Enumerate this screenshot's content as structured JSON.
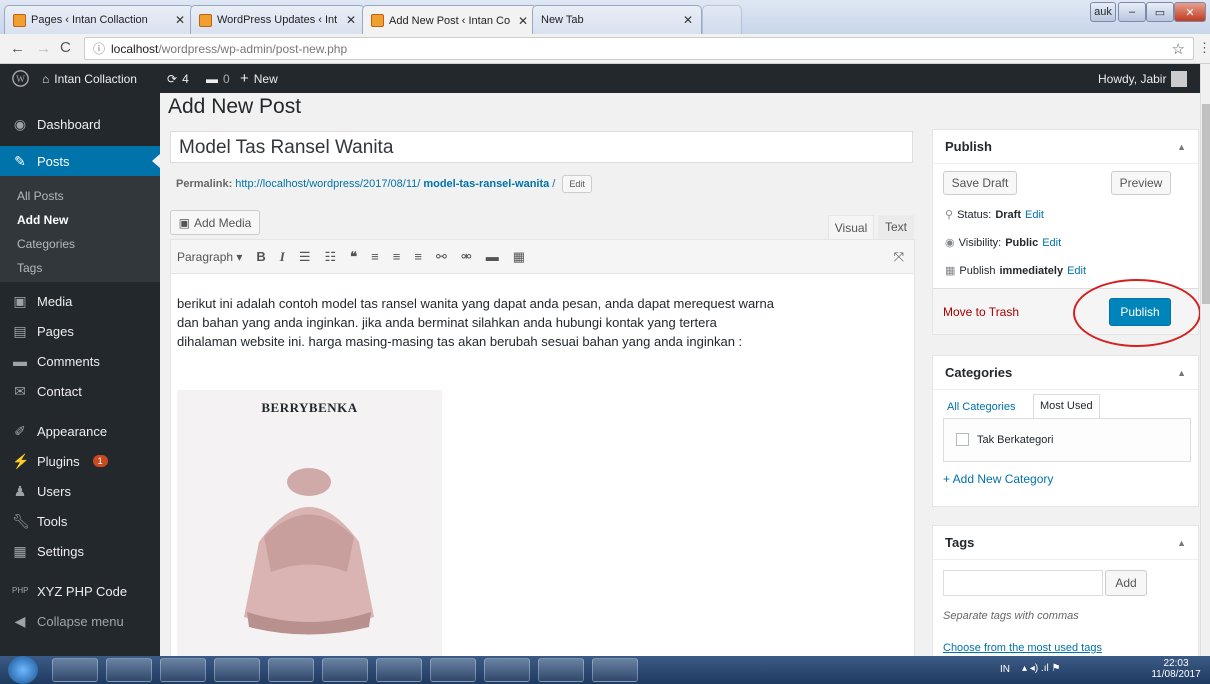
{
  "browser": {
    "tabs": [
      {
        "title": "Pages ‹ Intan Collaction"
      },
      {
        "title": "WordPress Updates ‹ Int"
      },
      {
        "title": "Add New Post ‹ Intan Co"
      },
      {
        "title": "New Tab"
      }
    ],
    "window_user": "auk",
    "url_host": "localhost",
    "url_path": "/wordpress/wp-admin/post-new.php"
  },
  "adminbar": {
    "site_name": "Intan Collaction",
    "updates_count": "4",
    "comments_count": "0",
    "new_label": "New",
    "greeting": "Howdy, Jabir"
  },
  "sidebar": {
    "items": [
      {
        "label": "Dashboard",
        "icon": "dashboard-icon"
      },
      {
        "label": "Posts",
        "icon": "pin-icon"
      },
      {
        "label": "Media",
        "icon": "media-icon"
      },
      {
        "label": "Pages",
        "icon": "pages-icon"
      },
      {
        "label": "Comments",
        "icon": "comment-icon"
      },
      {
        "label": "Contact",
        "icon": "mail-icon"
      },
      {
        "label": "Appearance",
        "icon": "brush-icon"
      },
      {
        "label": "Plugins",
        "icon": "plugin-icon"
      },
      {
        "label": "Users",
        "icon": "users-icon"
      },
      {
        "label": "Tools",
        "icon": "wrench-icon"
      },
      {
        "label": "Settings",
        "icon": "settings-icon"
      },
      {
        "label": "XYZ PHP Code",
        "icon": "php-icon"
      },
      {
        "label": "Collapse menu",
        "icon": "collapse-icon"
      }
    ],
    "submenu": [
      "All Posts",
      "Add New",
      "Categories",
      "Tags"
    ],
    "plugins_badge": "1"
  },
  "post": {
    "page_title": "Add New Post",
    "title_value": "Model Tas Ransel Wanita",
    "permalink_label": "Permalink:",
    "permalink_base": "http://localhost/wordpress/2017/08/11/",
    "permalink_slug": "model-tas-ransel-wanita",
    "permalink_edit": "Edit",
    "add_media": "Add Media",
    "tab_visual": "Visual",
    "tab_text": "Text",
    "format_select": "Paragraph",
    "content": "berikut ini adalah contoh model tas ransel wanita yang dapat anda pesan, anda dapat merequest warna dan bahan yang anda inginkan. jika anda berminat silahkan anda hubungi kontak yang tertera dihalaman website ini. harga masing-masing tas akan berubah sesuai bahan yang anda inginkan :",
    "image_brand": "BERRYBENKA"
  },
  "publish": {
    "heading": "Publish",
    "save_draft": "Save Draft",
    "preview": "Preview",
    "status_label": "Status:",
    "status_value": "Draft",
    "visibility_label": "Visibility:",
    "visibility_value": "Public",
    "schedule_label": "Publish",
    "schedule_value": "immediately",
    "edit": "Edit",
    "trash": "Move to Trash",
    "publish_button": "Publish"
  },
  "categories": {
    "heading": "Categories",
    "tab_all": "All Categories",
    "tab_used": "Most Used",
    "items": [
      "Tak Berkategori"
    ],
    "add_new": "+ Add New Category"
  },
  "tags": {
    "heading": "Tags",
    "add_button": "Add",
    "hint": "Separate tags with commas",
    "choose": "Choose from the most used tags"
  },
  "taskbar": {
    "lang": "IN",
    "time": "22:03",
    "date": "11/08/2017"
  },
  "colors": {
    "primary": "#0073aa",
    "adminbar": "#23282d",
    "annotation_circle": "#d32020"
  }
}
